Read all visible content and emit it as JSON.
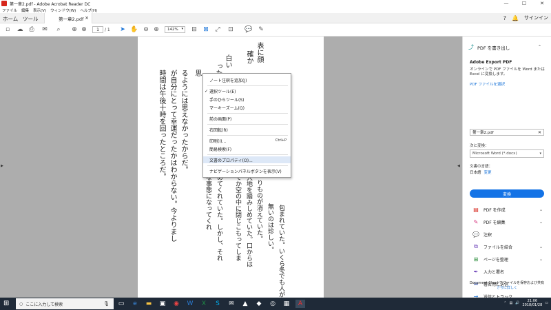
{
  "window": {
    "title": "第一章2.pdf - Adobe Acrobat Reader DC",
    "min": "—",
    "max": "☐",
    "close": "✕"
  },
  "menu": [
    "ファイル",
    "編集",
    "表示(V)",
    "ウィンドウ(W)",
    "ヘルプ(H)"
  ],
  "tabs": {
    "home": "ホーム",
    "tools": "ツール",
    "doc": "第一章2.pdf",
    "doc_close": "×",
    "help_icon": "?",
    "bell_icon": "🔔",
    "signin": "サインイン"
  },
  "toolbar": {
    "page_current": "1",
    "page_total": "/ 1",
    "zoom": "142%"
  },
  "document": {
    "columns": [
      "表に顔",
      "確か",
      "白い",
      "った",
      "思",
      "るようには思えなかったからだ。",
      "が自分にとって幸運だったかはわからない。今よりまし",
      "時間は午後十時を回ったところだ。"
    ],
    "columns_right": [
      "包まれていた。いくら冬でも人が",
      "無いのは珍しい。",
      "りものが消えていた。",
      "大地を踏みしめていた。口からは",
      "てか空の中に閉じこもってしま",
      "めてくれていた。しかし、それ",
      "な事態になってくれ"
    ]
  },
  "context_menu": [
    {
      "label": "ノート注釈を追加(J)"
    },
    {
      "label": "選択ツール(E)",
      "check": "✓"
    },
    {
      "label": "手のひらツール(S)"
    },
    {
      "label": "マーキーズーム(Q)"
    },
    {
      "label": "前の画面(P)"
    },
    {
      "label": "右回転(R)"
    },
    {
      "label": "印刷(I)...",
      "shortcut": "Ctrl+P"
    },
    {
      "label": "簡易検索(F)"
    },
    {
      "label": "文書のプロパティ(O)..."
    },
    {
      "label": "ナビゲーションパネルボタンを表示(V)"
    }
  ],
  "panel": {
    "header": "PDF を書き出し",
    "export_title": "Adobe Export PDF",
    "export_desc": "オンラインで PDF ファイルを Word または Excel に変換します。",
    "select_link": "PDF ファイルを選択",
    "file_name": "第一章2.pdf",
    "convert_to_label": "次に変換：",
    "convert_to_value": "Microsoft Word (*.docx)",
    "lang_label": "文書の言語：",
    "lang_value": "日本語",
    "lang_change": "変更",
    "convert_button": "変換",
    "tools": [
      {
        "label": "PDF を作成",
        "icon": "▤",
        "color": "#d7261c"
      },
      {
        "label": "PDF を編集",
        "icon": "✎",
        "color": "#d42e7b"
      },
      {
        "label": "注釈",
        "icon": "💬",
        "color": "#e8a317"
      },
      {
        "label": "ファイルを結合",
        "icon": "⧉",
        "color": "#6b3fb8"
      },
      {
        "label": "ページを整理",
        "icon": "⊞",
        "color": "#2f8f3f"
      },
      {
        "label": "入力と署名",
        "icon": "✒",
        "color": "#6b3fb8"
      },
      {
        "label": "署名用に送信",
        "icon": "✉",
        "color": "#3451a8"
      },
      {
        "label": "送信とトラック",
        "icon": "→",
        "color": "#1a74d8"
      }
    ],
    "footer_text": "Document Cloud でファイルを保存および共有",
    "footer_link": "さらに詳しく"
  },
  "taskbar": {
    "search_placeholder": "ここに入力して検索",
    "time": "21:06",
    "date": "2018/01/28"
  }
}
